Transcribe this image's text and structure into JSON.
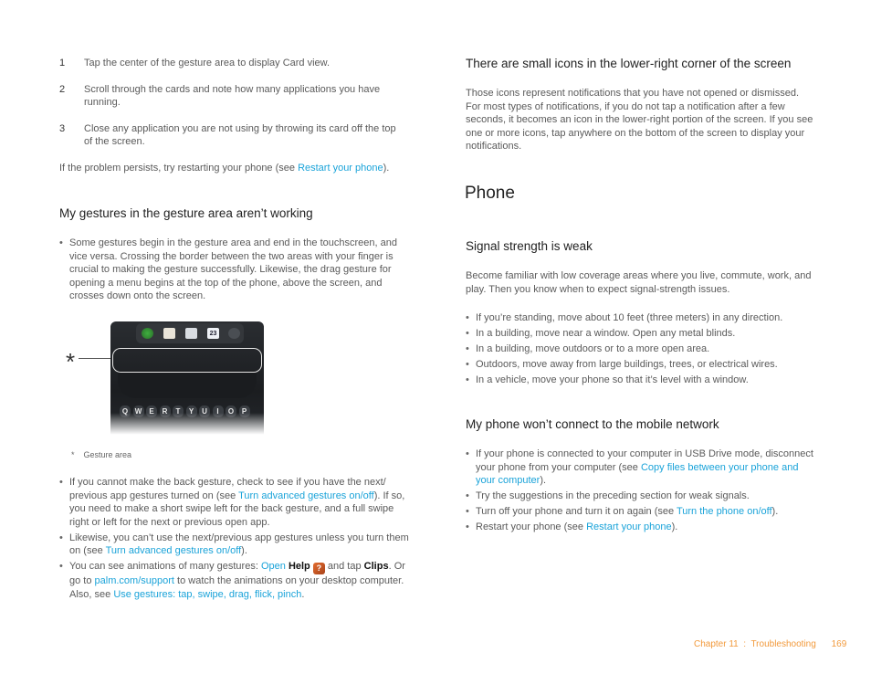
{
  "left": {
    "steps": [
      {
        "num": "1",
        "text": "Tap the center of the gesture area to display Card view."
      },
      {
        "num": "2",
        "text": "Scroll through the cards and note how many applications you have running."
      },
      {
        "num": "3",
        "text": "Close any application you are not using by throwing its card off the top of the screen."
      }
    ],
    "persist": {
      "pre": "If the problem persists, try restarting your phone (see ",
      "link": "Restart your phone",
      "post": ")."
    },
    "gestures_heading": "My gestures in the gesture area aren’t working",
    "gestures_bullet1": "Some gestures begin in the gesture area and end in the touchscreen, and vice versa. Crossing the border between the two areas with your finger is crucial to making the gesture successfully. Likewise, the drag gesture for opening a menu begins at the top of the phone, above the screen, and crosses down onto the screen.",
    "figure": {
      "callout_marker": "*",
      "caption_marker": "*",
      "caption": "Gesture area",
      "calendar_day": "23",
      "keys": [
        "Q",
        "W",
        "E",
        "R",
        "T",
        "Y",
        "U",
        "I",
        "O",
        "P"
      ]
    },
    "bullets2": [
      {
        "pre": "If you cannot make the back gesture, check to see if you have the next/ previous app gestures turned on (see ",
        "link": "Turn advanced gestures on/off",
        "post": "). If so, you need to make a short swipe left for the back gesture, and a full swipe right or left for the next or previous open app."
      },
      {
        "pre": "Likewise, you can’t use the next/previous app gestures unless you turn them on (see ",
        "link": "Turn advanced gestures on/off",
        "post": ")."
      },
      {
        "pre": "You can see animations of many gestures: ",
        "link": "Open",
        "bold1": "Help",
        "icon": "help-app-icon",
        "mid": " and tap ",
        "bold2": "Clips",
        "mid2": ". Or go to ",
        "link2": "palm.com/support",
        "mid3": " to watch the animations on your desktop computer. Also, see ",
        "link3": "Use gestures: tap, swipe, drag, flick, pinch",
        "post": "."
      }
    ]
  },
  "right": {
    "icons_heading": "There are small icons in the lower-right corner of the screen",
    "icons_body": "Those icons represent notifications that you have not opened or dismissed. For most types of notifications, if you do not tap a notification after a few seconds, it becomes an icon in the lower-right portion of the screen. If you see one or more icons, tap anywhere on the bottom of the screen to display your notifications.",
    "phone_title": "Phone",
    "signal_heading": "Signal strength is weak",
    "signal_body": "Become familiar with low coverage areas where you live, commute, work, and play. Then you know when to expect signal-strength issues.",
    "signal_bullets": [
      "If you’re standing, move about 10 feet (three meters) in any direction.",
      "In a building, move near a window. Open any metal blinds.",
      "In a building, move outdoors or to a more open area.",
      "Outdoors, move away from large buildings, trees, or electrical wires.",
      "In a vehicle, move your phone so that it’s level with a window."
    ],
    "network_heading": "My phone won’t connect to the mobile network",
    "network_bullets": [
      {
        "pre": "If your phone is connected to your computer in USB Drive mode, disconnect your phone from your computer (see ",
        "link": "Copy files between your phone and your computer",
        "post": ")."
      },
      {
        "pre": "Try the suggestions in the preceding section for weak signals.",
        "link": "",
        "post": ""
      },
      {
        "pre": "Turn off your phone and turn it on again (see ",
        "link": "Turn the phone on/off",
        "post": ")."
      },
      {
        "pre": "Restart your phone (see ",
        "link": "Restart your phone",
        "post": ")."
      }
    ]
  },
  "footer": {
    "chapter": "Chapter 11  :  Troubleshooting",
    "page": "169"
  },
  "colors": {
    "link": "#1aa3d9",
    "footer": "#f29a3c"
  }
}
